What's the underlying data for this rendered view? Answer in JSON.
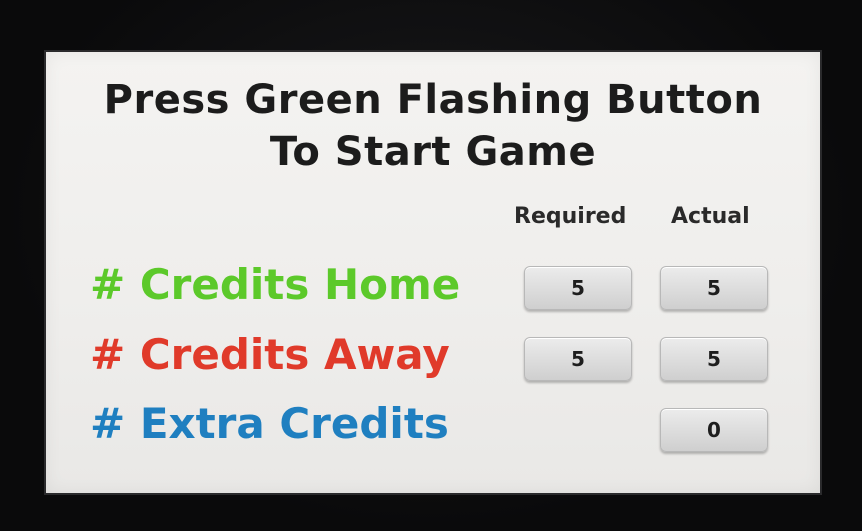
{
  "title": {
    "line1": "Press Green Flashing Button",
    "line2": "To Start Game"
  },
  "columns": {
    "required": "Required",
    "actual": "Actual"
  },
  "rows": [
    {
      "label": "# Credits Home",
      "color": "#5cc92a",
      "required": "5",
      "actual": "5"
    },
    {
      "label": "# Credits Away",
      "color": "#e03a2a",
      "required": "5",
      "actual": "5"
    },
    {
      "label": "# Extra Credits",
      "color": "#1f7fc0",
      "required": null,
      "actual": "0"
    }
  ]
}
